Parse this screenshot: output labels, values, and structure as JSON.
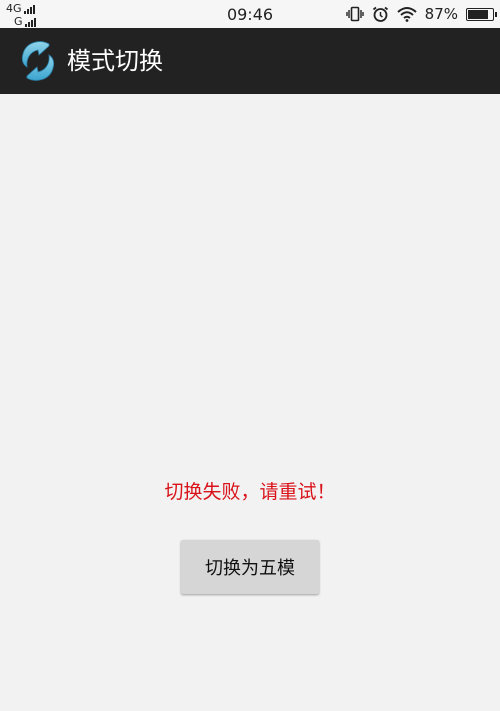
{
  "status_bar": {
    "signal_1_label": "4G",
    "signal_2_label": "G",
    "time": "09:46",
    "battery_percent": "87%",
    "battery_level": 0.87,
    "icons": [
      "vibrate-icon",
      "alarm-icon",
      "wifi-icon",
      "battery-icon"
    ]
  },
  "app_bar": {
    "title": "模式切换",
    "icon": "sync-arrows-icon",
    "background": "#222222",
    "title_color": "#ffffff"
  },
  "main": {
    "error_message": "切换失败，请重试！",
    "error_color": "#d9131a",
    "switch_button_label": "切换为五模"
  }
}
